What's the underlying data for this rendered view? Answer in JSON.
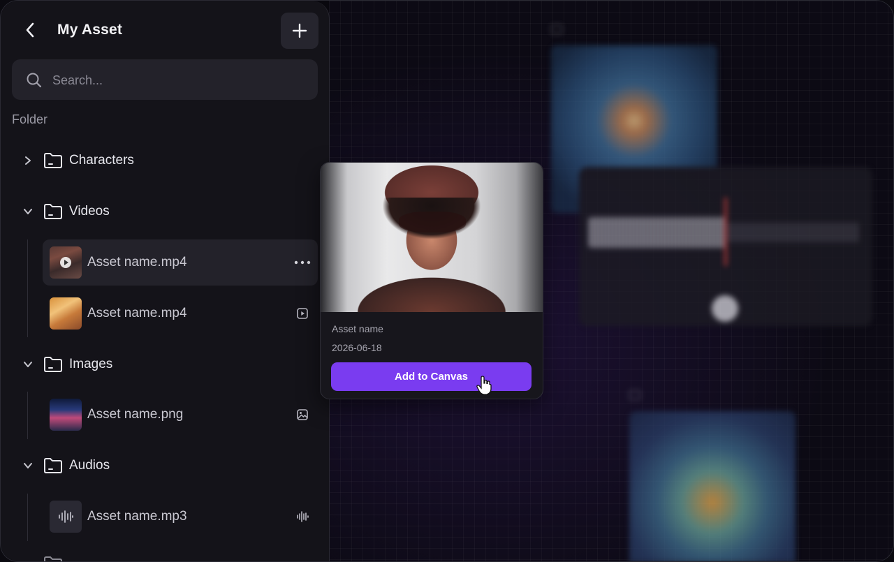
{
  "sidebar": {
    "title": "My Asset",
    "back_icon": "chevron-left-icon",
    "add_icon": "plus-icon",
    "search": {
      "placeholder": "Search..."
    },
    "section_label": "Folder",
    "folders": [
      {
        "label": "Characters",
        "expanded": false
      },
      {
        "label": "Videos",
        "expanded": true
      },
      {
        "label": "Images",
        "expanded": true
      },
      {
        "label": "Audios",
        "expanded": true
      }
    ],
    "assets": {
      "videos": [
        {
          "label": "Asset name.mp4",
          "tail_icon": "more-horizontal-icon",
          "selected": true
        },
        {
          "label": "Asset name.mp4",
          "tail_icon": "video-icon",
          "selected": false
        }
      ],
      "images": [
        {
          "label": "Asset name.png",
          "tail_icon": "image-icon"
        }
      ],
      "audios": [
        {
          "label": "Asset name.mp3",
          "tail_icon": "waveform-icon"
        }
      ]
    }
  },
  "preview_card": {
    "name": "Asset name",
    "date": "2026-06-18",
    "button_label": "Add to Canvas"
  },
  "colors": {
    "accent": "#7a3cf0",
    "sidebar_bg": "#141319",
    "canvas_bg": "#0c0a14"
  }
}
